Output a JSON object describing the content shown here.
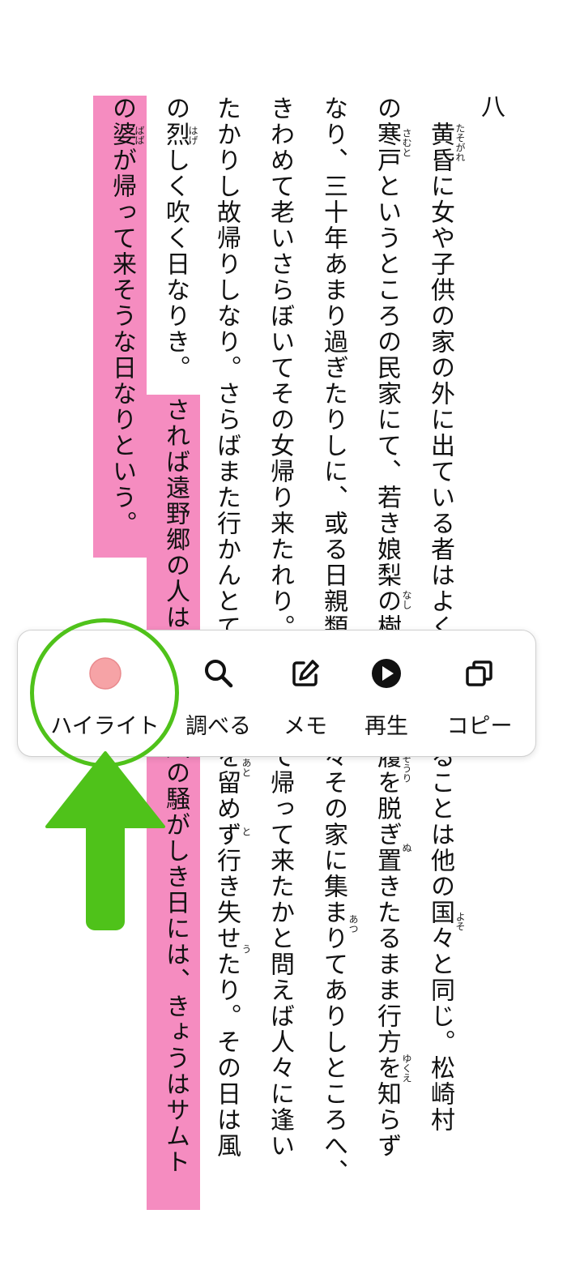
{
  "book": {
    "chapter_mark": "八",
    "columns": [
      "黄昏に女や子供の家の外に出ている者はよくかくさるることは他の国々と同じ。松崎村",
      "の寒戸というところの民家にて、若き娘梨の樹の下に草履を脱ぎ置きたるまま行方を知らず",
      "なり、三十年あまり過ぎたりしに、或る日親類知音の人々その家に集まりてありしところへ、",
      "きわめて老いさらぼいてその女帰り来たれり。いかにして帰って来たかと問えば人々に逢い",
      "たかりし故帰りしなり。さらばまた行かんとて、再び跡を留めず行き失せたり。その日は風",
      "の烈しく吹く日なりき。",
      "されば遠野郷の人は、今でも風の騒がしき日には、きょうはサムト",
      "の婆が帰って来そうな日なりという。"
    ],
    "ruby": [
      "たそがれ",
      "さむと",
      "なし",
      "ぞうり",
      "ぬ",
      "あつ",
      "よそ",
      "ゆくえ",
      "あと",
      "と",
      "う",
      "はげ",
      "ばば"
    ]
  },
  "popup": {
    "items": [
      {
        "label": "ハイライト",
        "icon": "highlight-dot-icon"
      },
      {
        "label": "調べる",
        "icon": "search-icon"
      },
      {
        "label": "メモ",
        "icon": "memo-edit-icon"
      },
      {
        "label": "再生",
        "icon": "play-icon"
      },
      {
        "label": "コピー",
        "icon": "copy-icon"
      }
    ]
  },
  "colors": {
    "highlight_pink": "#f58cc0",
    "annotation_green": "#4fc21a",
    "highlight_dot": "#f6a3a6"
  }
}
